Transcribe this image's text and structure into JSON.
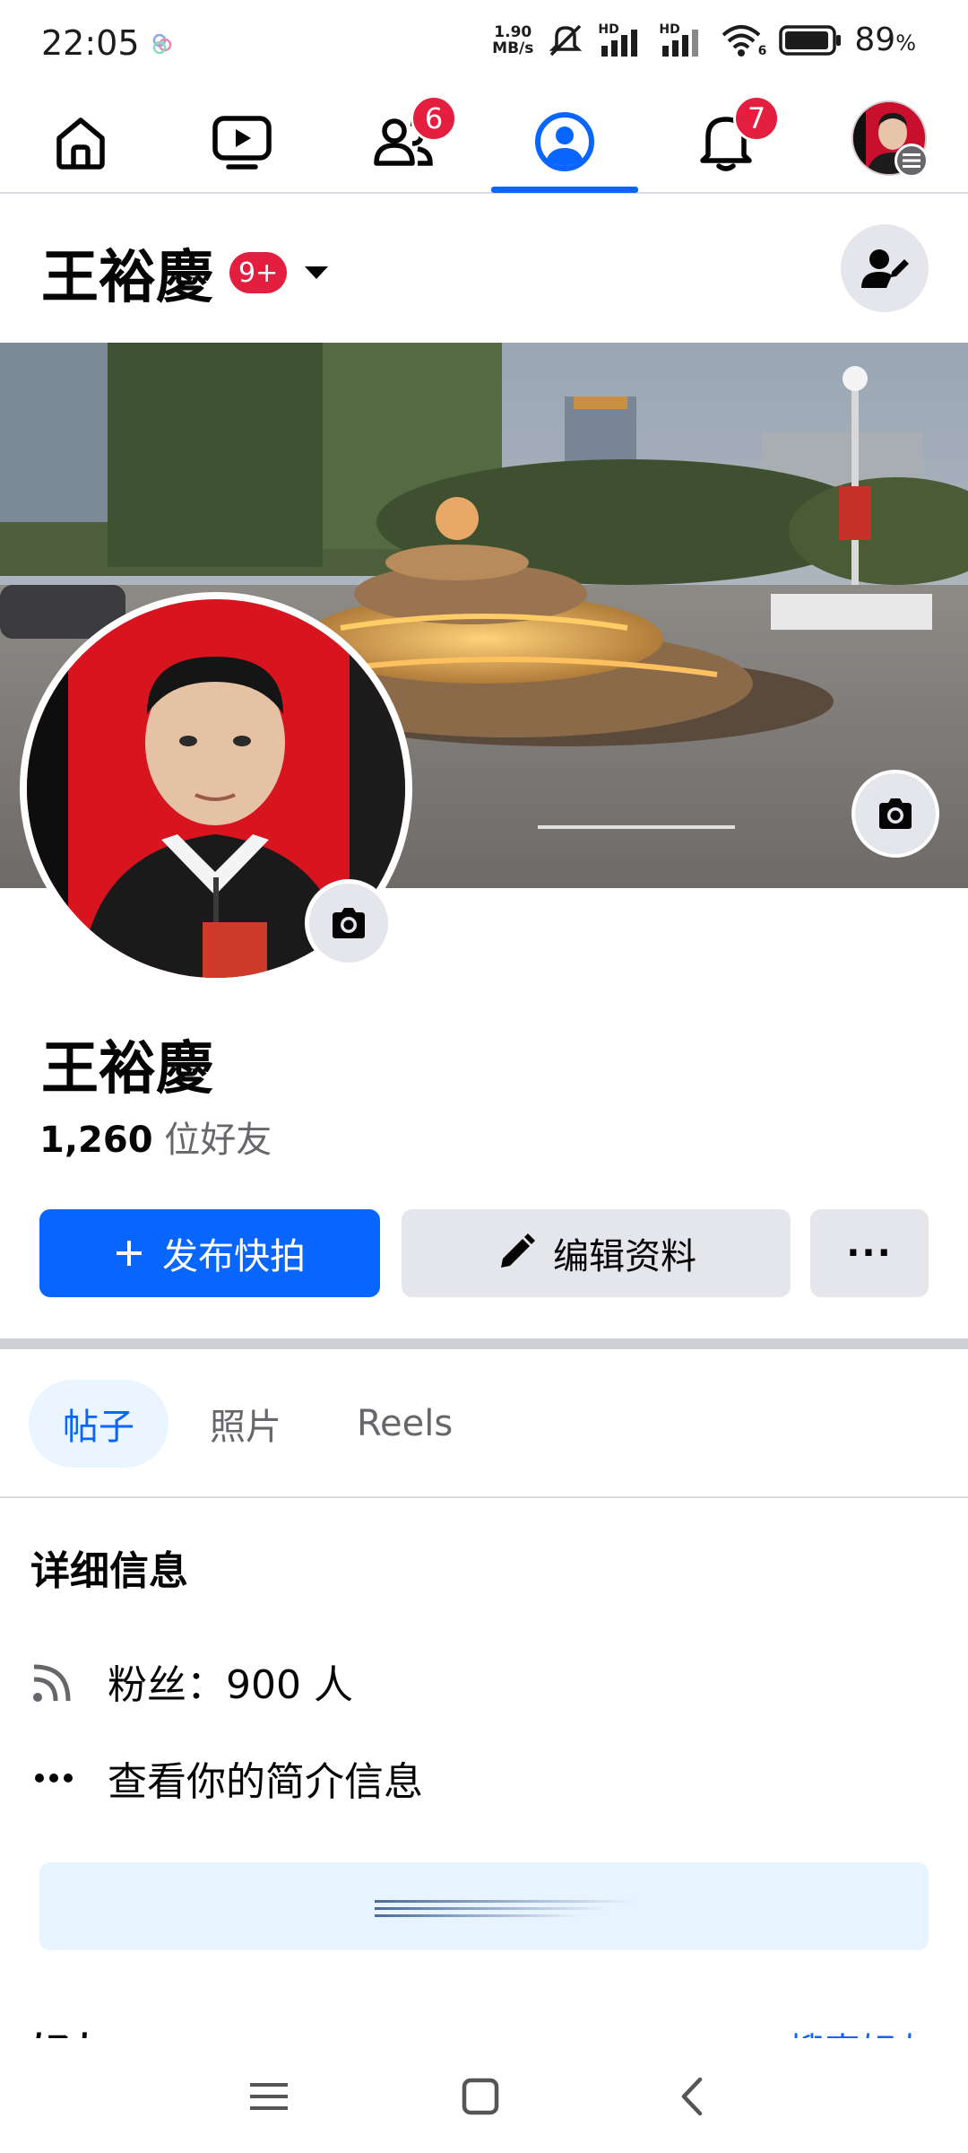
{
  "status_bar": {
    "time": "22:05",
    "net_speed_value": "1.90",
    "net_speed_unit": "MB/s",
    "signal_1_label": "HD",
    "signal_2_label": "HD",
    "wifi_label": "6",
    "battery": "89",
    "battery_unit": "%"
  },
  "top_nav": {
    "items": [
      {
        "name": "home",
        "icon": "home-icon"
      },
      {
        "name": "video",
        "icon": "video-icon"
      },
      {
        "name": "friends",
        "icon": "friends-icon",
        "badge": "6"
      },
      {
        "name": "profile",
        "icon": "profile-icon",
        "active": true
      },
      {
        "name": "notifications",
        "icon": "bell-icon",
        "badge": "7"
      },
      {
        "name": "menu",
        "icon": "avatar-menu-icon"
      }
    ]
  },
  "profile": {
    "header_name": "王裕慶",
    "header_badge": "9+",
    "display_name": "王裕慶",
    "friend_count": "1,260",
    "friend_label": "位好友"
  },
  "actions": {
    "primary_label": "发布快拍",
    "primary_icon": "+",
    "edit_label": "编辑资料",
    "more_label": "···"
  },
  "tabs": [
    {
      "label": "帖子",
      "active": true
    },
    {
      "label": "照片",
      "active": false
    },
    {
      "label": "Reels",
      "active": false
    }
  ],
  "details": {
    "title": "详细信息",
    "followers": "粉丝：900 人",
    "see_about": "查看你的简介信息"
  },
  "friends_section": {
    "title": "好友",
    "see_all": "搜索好友"
  },
  "colors": {
    "accent": "#0866ff",
    "badge": "#e41e3f",
    "button_gray": "#e4e6eb",
    "tab_active_bg": "#ebf5ff"
  }
}
